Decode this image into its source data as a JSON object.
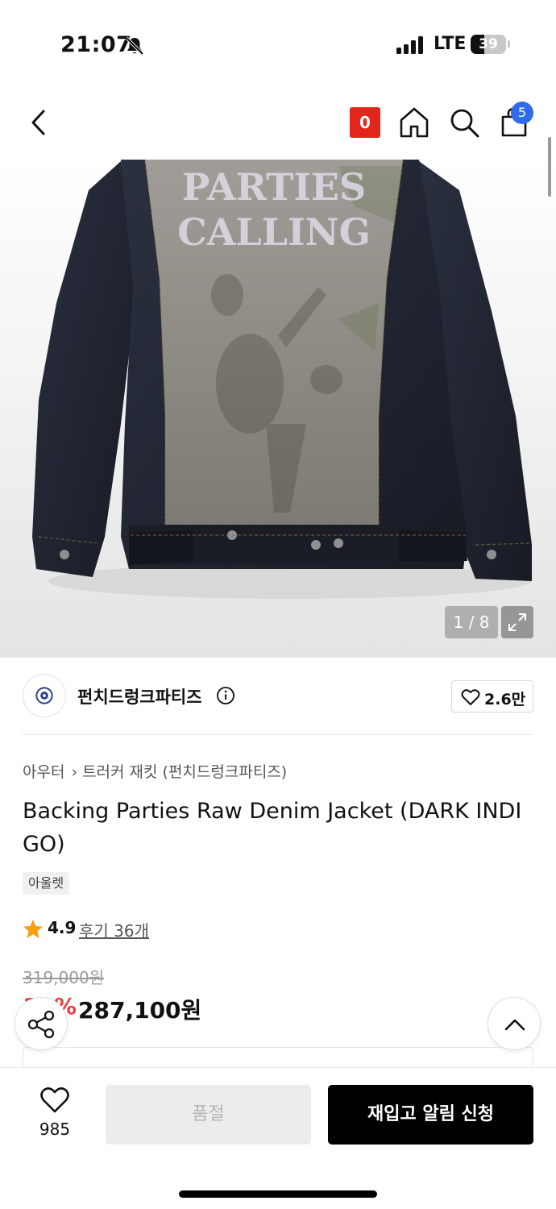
{
  "status_bar": {
    "time": "21:07",
    "network": "LTE",
    "battery": "39",
    "battery_level": 0.39
  },
  "nav": {
    "badge_label": "0",
    "cart_count": "5",
    "icons": [
      "back-chevron-icon",
      "home-icon",
      "search-icon",
      "shopping-bag-icon"
    ]
  },
  "product_image": {
    "counter": "1 / 8",
    "artwork_text_line1": "PARTIES",
    "artwork_text_line2": "CALLING",
    "colors": {
      "denim": "#1f2330",
      "panel": "#8f8b85"
    }
  },
  "brand": {
    "name": "펀치드렁크파티즈",
    "likes": "2.6만"
  },
  "breadcrumb": {
    "category": "아우터",
    "subcategory": "트러커 재킷 (펀치드렁크파티즈)"
  },
  "product": {
    "title": "Backing Parties Raw Denim Jacket (DARK INDIGO)",
    "tag": "아울렛",
    "rating": "4.9",
    "reviews": "후기 36개",
    "original_price": "319,000원",
    "discount": "10%",
    "sale_price": "287,100원"
  },
  "bottom_bar": {
    "wish_count": "985",
    "soldout_label": "품절",
    "restock_label": "재입고 알림 신청"
  },
  "colors": {
    "accent_red": "#ee1c25",
    "badge_red": "#e1261c",
    "cart_blue": "#2f6bea",
    "primary_black": "#000000"
  }
}
